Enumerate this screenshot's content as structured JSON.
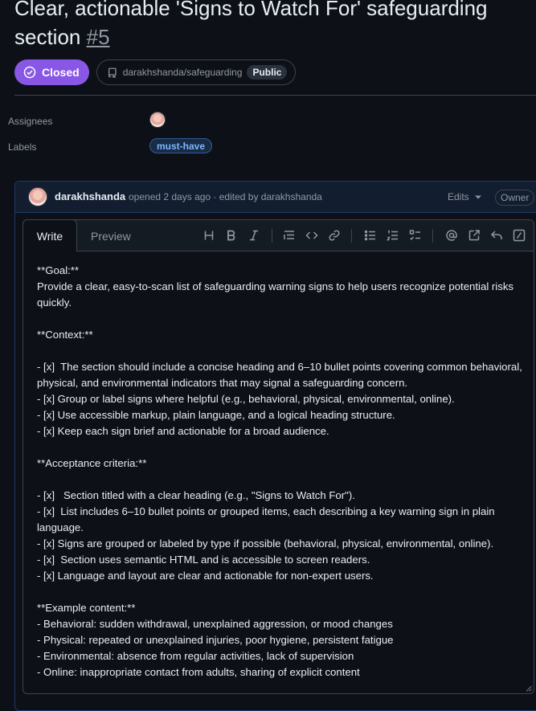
{
  "issue": {
    "title_text": "Clear, actionable 'Signs to Watch For' safeguarding section",
    "number": "#5",
    "status": "Closed",
    "repo": "darakhshanda/safeguarding",
    "visibility": "Public"
  },
  "meta": {
    "assignees_label": "Assignees",
    "labels_label": "Labels",
    "label_tag": "must-have"
  },
  "comment": {
    "author": "darakhshanda",
    "opened_text": "opened 2 days ago · edited by darakhshanda",
    "edits_label": "Edits",
    "role_badge": "Owner"
  },
  "editor": {
    "tab_write": "Write",
    "tab_preview": "Preview",
    "toolbar_icons": [
      "heading-icon",
      "bold-icon",
      "italic-icon",
      "quote-icon",
      "code-icon",
      "link-icon",
      "unordered-list-icon",
      "ordered-list-icon",
      "task-list-icon",
      "mention-icon",
      "cross-reference-icon",
      "saved-reply-icon",
      "slash-command-icon"
    ],
    "content": "**Goal:**\nProvide a clear, easy-to-scan list of safeguarding warning signs to help users recognize potential risks quickly.\n\n**Context:**\n\n- [x]  The section should include a concise heading and 6–10 bullet points covering common behavioral, physical, and environmental indicators that may signal a safeguarding concern.\n- [x] Group or label signs where helpful (e.g., behavioral, physical, environmental, online).\n- [x] Use accessible markup, plain language, and a logical heading structure.\n- [x] Keep each sign brief and actionable for a broad audience.\n\n**Acceptance criteria:**\n\n- [x]   Section titled with a clear heading (e.g., \"Signs to Watch For\").\n- [x]  List includes 6–10 bullet points or grouped items, each describing a key warning sign in plain language.\n- [x] Signs are grouped or labeled by type if possible (behavioral, physical, environmental, online).\n- [x]  Section uses semantic HTML and is accessible to screen readers.\n- [x] Language and layout are clear and actionable for non-expert users.\n\n**Example content:**\n- Behavioral: sudden withdrawal, unexplained aggression, or mood changes\n- Physical: repeated or unexplained injuries, poor hygiene, persistent fatigue\n- Environmental: absence from regular activities, lack of supervision\n- Online: inappropriate contact from adults, sharing of explicit content"
  },
  "colors": {
    "background": "#0d1117",
    "closed_badge": "#8957e5",
    "label_text": "#79b8ff",
    "muted_text": "#9198a1"
  }
}
